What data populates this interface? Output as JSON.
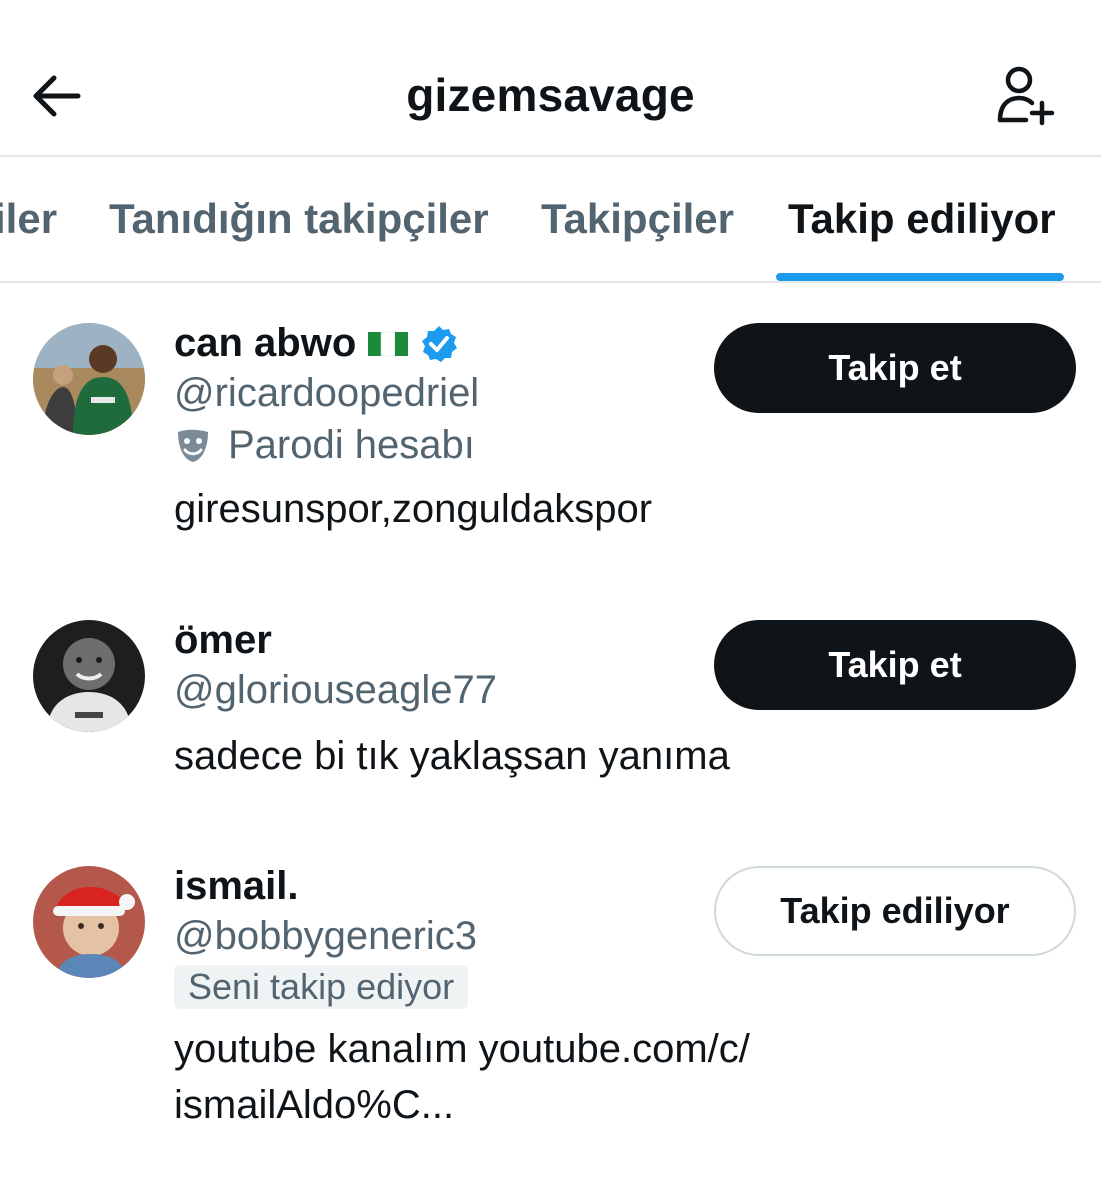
{
  "header": {
    "title": "gizemsavage",
    "back_icon": "arrow-left-icon",
    "add_user_icon": "add-user-icon"
  },
  "tabs": [
    {
      "label": "iler",
      "active": false
    },
    {
      "label": "Tanıdığın takipçiler",
      "active": false
    },
    {
      "label": "Takipçiler",
      "active": false
    },
    {
      "label": "Takip ediliyor",
      "active": true
    }
  ],
  "colors": {
    "accent": "#1d9bf0",
    "text_primary": "#0f1419",
    "text_secondary": "#536471",
    "button_dark": "#0f1419",
    "verified": "#1d9bf0"
  },
  "users": [
    {
      "name": "can abwo",
      "flag": "nigeria-flag-icon",
      "verified": true,
      "handle": "@ricardoopedriel",
      "parody_label": "Parodi hesabı",
      "bio": "giresunspor,zonguldakspor",
      "button_label": "Takip et",
      "following": false
    },
    {
      "name": "ömer",
      "handle": "@gloriouseagle77",
      "bio": "sadece bi tık yaklaşsan yanıma",
      "button_label": "Takip et",
      "following": false
    },
    {
      "name": "ismail.",
      "handle": "@bobbygeneric3",
      "follows_you": "Seni takip ediyor",
      "bio": "youtube kanalım youtube.com/c/ ismailAldo%C...",
      "button_label": "Takip ediliyor",
      "following": true
    }
  ]
}
